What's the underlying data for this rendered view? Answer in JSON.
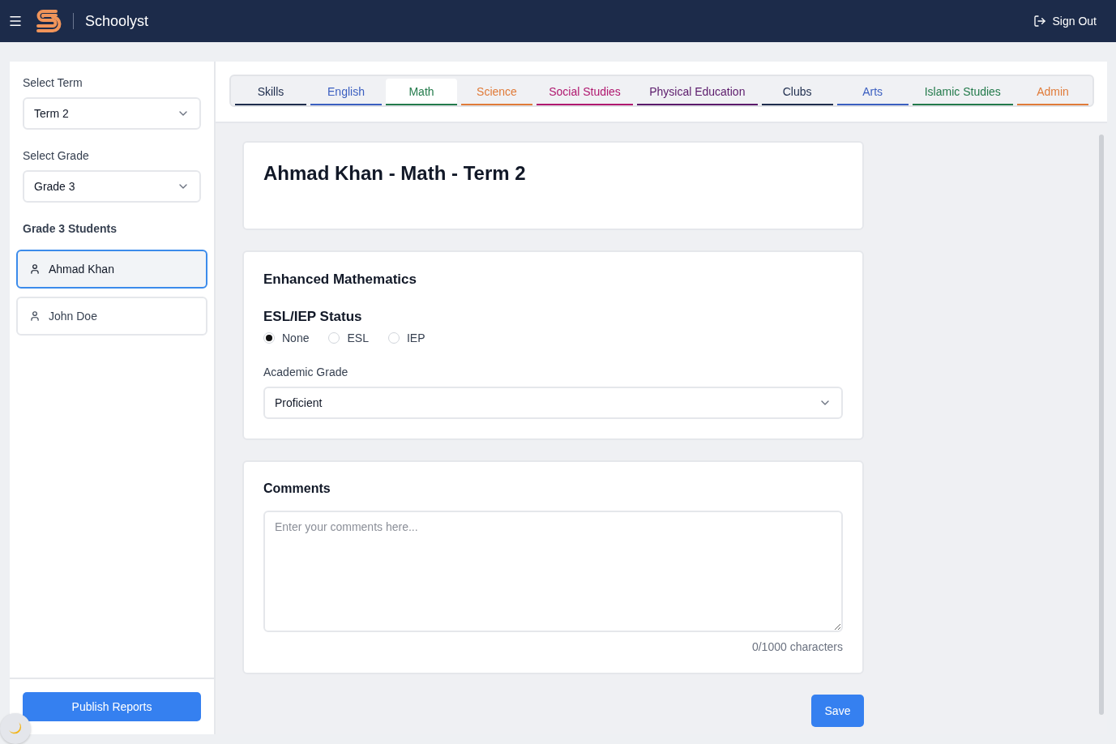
{
  "header": {
    "app_name": "Schoolyst",
    "sign_out": "Sign Out"
  },
  "sidebar": {
    "term_label": "Select Term",
    "term_value": "Term 2",
    "grade_label": "Select Grade",
    "grade_value": "Grade 3",
    "students_heading": "Grade 3 Students",
    "students": [
      {
        "name": "Ahmad Khan",
        "selected": true
      },
      {
        "name": "John Doe",
        "selected": false
      }
    ],
    "publish": "Publish Reports"
  },
  "tabs": [
    {
      "label": "Skills",
      "color": "#1e2d4d",
      "selected": false
    },
    {
      "label": "English",
      "color": "#3b5fc0",
      "selected": false
    },
    {
      "label": "Math",
      "color": "#237a4b",
      "selected": true
    },
    {
      "label": "Science",
      "color": "#e07b39",
      "selected": false
    },
    {
      "label": "Social Studies",
      "color": "#b0186f",
      "selected": false
    },
    {
      "label": "Physical Education",
      "color": "#5b1a6b",
      "selected": false
    },
    {
      "label": "Clubs",
      "color": "#1e2d4d",
      "selected": false
    },
    {
      "label": "Arts",
      "color": "#3b5fc0",
      "selected": false
    },
    {
      "label": "Islamic Studies",
      "color": "#237a4b",
      "selected": false
    },
    {
      "label": "Admin",
      "color": "#e07b39",
      "selected": false
    }
  ],
  "title": "Ahmad Khan - Math - Term 2",
  "subject_card": {
    "heading": "Enhanced Mathematics",
    "status_label": "ESL/IEP Status",
    "status_options": [
      {
        "label": "None",
        "selected": true
      },
      {
        "label": "ESL",
        "selected": false
      },
      {
        "label": "IEP",
        "selected": false
      }
    ],
    "grade_label": "Academic Grade",
    "grade_value": "Proficient"
  },
  "comments": {
    "heading": "Comments",
    "placeholder": "Enter your comments here...",
    "counter": "0/1000 characters"
  },
  "save": "Save"
}
